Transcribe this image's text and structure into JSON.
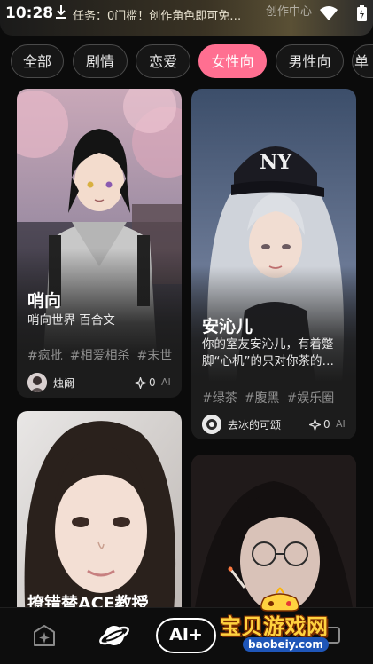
{
  "status_bar": {
    "time": "10:28",
    "notice": "任务：0门槛！创作角色即可免…",
    "right_text": "创作中心",
    "icons": [
      "download-icon",
      "wifi-icon",
      "battery-icon"
    ]
  },
  "categories": [
    {
      "label": "全部",
      "active": false
    },
    {
      "label": "剧情",
      "active": false
    },
    {
      "label": "恋爱",
      "active": false
    },
    {
      "label": "女性向",
      "active": true
    },
    {
      "label": "男性向",
      "active": false
    },
    {
      "label": "单",
      "active": false
    }
  ],
  "cards": [
    {
      "title": "哨向",
      "description": "哨向世界 百合文",
      "tags": [
        "#疯批",
        "#相爱相杀",
        "#末世"
      ],
      "author": "烛阚",
      "likes": "0",
      "badge": "AI"
    },
    {
      "title": "安沁儿",
      "description": "你的室友安沁儿，有着蹩脚“心机”的只对你茶的…",
      "tags": [
        "#绿茶",
        "#腹黑",
        "#娱乐圈"
      ],
      "author": "去冰的可颂",
      "likes": "0",
      "badge": "AI"
    },
    {
      "title": "撩错替ACE教授后…",
      "description": "",
      "tags": [],
      "author": "",
      "likes": "",
      "badge": ""
    },
    {
      "title": "",
      "description": "",
      "tags": [],
      "author": "",
      "likes": "",
      "badge": ""
    }
  ],
  "bottom_nav": {
    "items": [
      {
        "icon": "sparkle-home-icon"
      },
      {
        "icon": "planet-icon"
      },
      {
        "label": "AI+"
      },
      {
        "icon": "chat-icon"
      }
    ]
  },
  "watermark": {
    "text": "宝贝游戏网",
    "url": "baobeiy.com"
  },
  "colors": {
    "accent": "#ff6f91",
    "background": "#0b0b0b",
    "card": "#1c1c1c",
    "tag_text": "#8f8f8f"
  }
}
